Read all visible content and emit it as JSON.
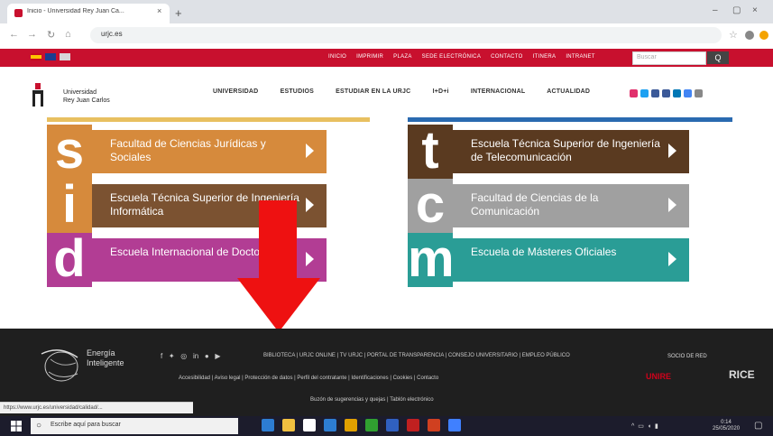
{
  "browser": {
    "tab_title": "Inicio - Universidad Rey Juan Ca...",
    "tab_close": "×",
    "new_tab": "+",
    "address": "urjc.es",
    "window_controls": [
      "–",
      "▢",
      "×"
    ],
    "nav_icons": [
      "back-icon",
      "forward-icon",
      "reload-icon",
      "home-icon"
    ]
  },
  "site_topbar": {
    "links": [
      "INICIO",
      "IMPRIMIR",
      "PLAZA",
      "SEDE ELECTRÓNICA",
      "CONTACTO",
      "ITINERA",
      "INTRANET"
    ],
    "search_placeholder": "Buscar",
    "search_button": "Q"
  },
  "site_header": {
    "logo_line1": "Universidad",
    "logo_line2": "Rey Juan Carlos",
    "nav": [
      "UNIVERSIDAD",
      "ESTUDIOS",
      "ESTUDIAR EN LA URJC",
      "I+D+i",
      "INTERNACIONAL",
      "ACTUALIDAD"
    ],
    "social_colors": [
      "#e1306c",
      "#1da1f2",
      "#3b5998",
      "#3b5998",
      "#0077b5",
      "#4285f4",
      "#888888"
    ]
  },
  "schools": [
    {
      "letter": "s",
      "title": "Facultad de Ciencias Jurídicas y Sociales",
      "color": "#d68a3c",
      "letter_color": "#d68a3c"
    },
    {
      "letter": "t",
      "title": "Escuela Técnica Superior de Ingeniería de Telecomunicación",
      "color": "#5a3a20",
      "letter_color": "#5a3a20"
    },
    {
      "letter": "i",
      "title": "Escuela Técnica Superior de Ingeniería Informática",
      "color": "#7b5231",
      "letter_color": "#d68a3c"
    },
    {
      "letter": "c",
      "title": "Facultad de Ciencias de la Comunicación",
      "color": "#a0a0a0",
      "letter_color": "#a0a0a0"
    },
    {
      "letter": "d",
      "title": "Escuela Internacional de Doctorado",
      "color": "#b23d94",
      "letter_color": "#b23d94"
    },
    {
      "letter": "m",
      "title": "Escuela de Másteres Oficiales",
      "color": "#2a9d96",
      "letter_color": "#2a9d96"
    }
  ],
  "footer": {
    "brand_line1": "Energía",
    "brand_line2": "Inteligente",
    "links_row1": [
      "BIBLIOTECA",
      "URJC ONLINE",
      "TV URJC",
      "PORTAL DE TRANSPARENCIA",
      "CONSEJO UNIVERSITARIO",
      "EMPLEO PÚBLICO"
    ],
    "links_row2": [
      "Accesibilidad",
      "Aviso legal",
      "Protección de datos",
      "Perfil del contratante",
      "Identificaciones",
      "Cookies",
      "Contacto"
    ],
    "links_row3": [
      "Buzón de sugerencias y quejas",
      "Tablón electrónico"
    ],
    "partner_label": "SOCIO DE RED",
    "partner1": "UNIRE",
    "partner2": "RICE"
  },
  "statusbar": {
    "text": "https://www.urjc.es/universidad/calidad/..."
  },
  "taskbar": {
    "search_placeholder": "Escribe aquí para buscar",
    "clock_time": "0:14",
    "clock_date": "25/05/2020",
    "app_colors": [
      "#2d7dd2",
      "#f0c040",
      "#ffffff",
      "#2d7dd2",
      "#e0a000",
      "#30a030",
      "#3060c0",
      "#c02020",
      "#d04020",
      "#4080ff"
    ]
  }
}
